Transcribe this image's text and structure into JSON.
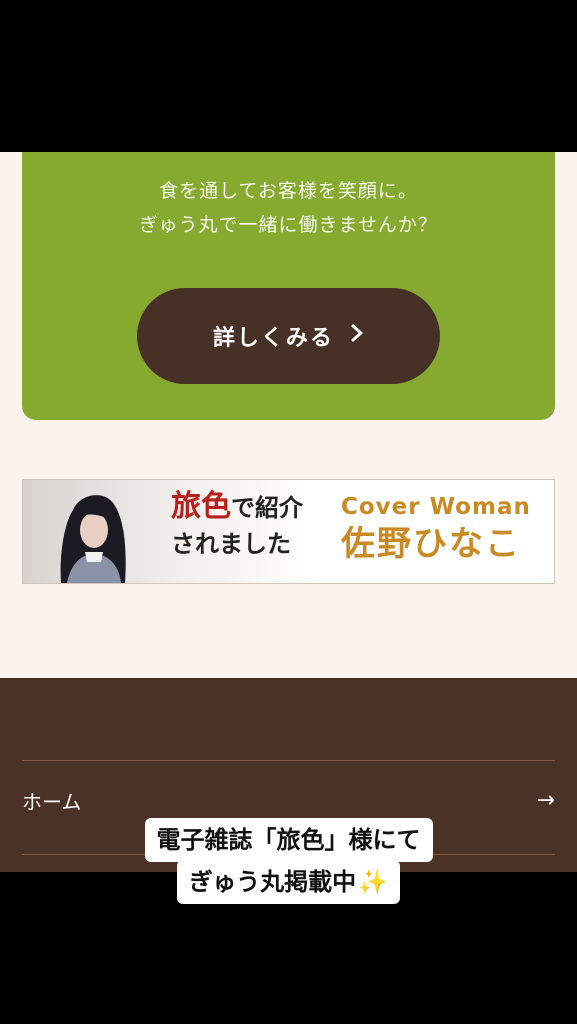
{
  "recruit": {
    "line1": "食を通してお客様を笑顔に。",
    "line2": "ぎゅう丸で一緒に働きませんか？",
    "button_label": "詳しくみる",
    "button_chevron": "〉"
  },
  "banner": {
    "magazine": "旅色",
    "intro_rest": "で紹介",
    "intro_line2": "されました",
    "cover_label": "Cover Woman",
    "person_name": "佐野ひなこ"
  },
  "footer": {
    "home_label": "ホーム",
    "home_arrow": "→"
  },
  "caption": {
    "line1": "電子雑誌「旅色」様にて",
    "line2": "ぎゅう丸掲載中",
    "sparkle": "✨"
  },
  "colors": {
    "green": "#86a92f",
    "brown": "#473126",
    "footer_brown": "#4a3226",
    "page_bg": "#fbf3ed",
    "accent_red": "#b8211b",
    "accent_gold": "#c98a24"
  },
  "icons": [
    "chevron-right-icon",
    "arrow-right-icon",
    "sparkles-icon"
  ]
}
